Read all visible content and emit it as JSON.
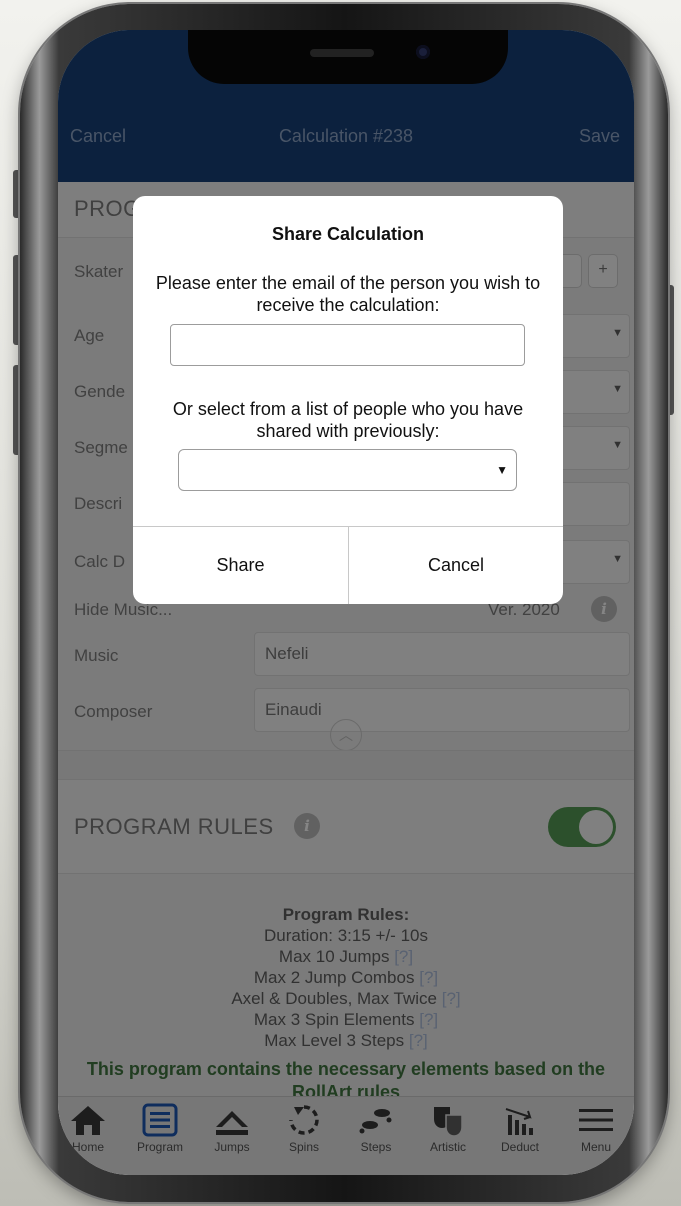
{
  "nav": {
    "cancel": "Cancel",
    "title": "Calculation #238",
    "save": "Save"
  },
  "program_section": {
    "title": "PROG",
    "skater_label": "Skater",
    "age_label": "Age",
    "gender_label": "Gende",
    "segment_label": "Segme",
    "description_label": "Descri",
    "calc_label": "Calc D",
    "add_button": "+",
    "hide_music": "Hide Music...",
    "version": "Ver.  2020",
    "music_label": "Music",
    "music_value": "Nefeli",
    "composer_label": "Composer",
    "composer_value": "Einaudi"
  },
  "rules_section": {
    "title": "PROGRAM RULES",
    "heading": "Program Rules:",
    "lines": [
      "Duration: 3:15 +/- 10s",
      "Max 10 Jumps",
      "Max 2 Jump Combos",
      "Axel & Doubles, Max Twice",
      "Max 3 Spin Elements",
      "Max Level 3 Steps"
    ],
    "help": "[?]",
    "note": "This program contains the necessary elements based on the RollArt rules"
  },
  "tabs": [
    {
      "label": "Home",
      "icon": "home-icon"
    },
    {
      "label": "Program",
      "icon": "list-icon"
    },
    {
      "label": "Jumps",
      "icon": "jump-icon"
    },
    {
      "label": "Spins",
      "icon": "spin-icon"
    },
    {
      "label": "Steps",
      "icon": "steps-icon"
    },
    {
      "label": "Artistic",
      "icon": "theater-masks-icon"
    },
    {
      "label": "Deduct",
      "icon": "deduct-chart-icon"
    },
    {
      "label": "Menu",
      "icon": "hamburger-icon"
    }
  ],
  "modal": {
    "title": "Share Calculation",
    "prompt_email": "Please enter the email of the person you wish to receive the calculation:",
    "email_value": "",
    "prompt_list": "Or select from a list of people who you have shared with previously:",
    "list_value": "",
    "share": "Share",
    "cancel": "Cancel"
  },
  "colors": {
    "header": "#153a6b",
    "accent_green": "#4d8a4d",
    "tab_active": "#1a4fa0"
  }
}
